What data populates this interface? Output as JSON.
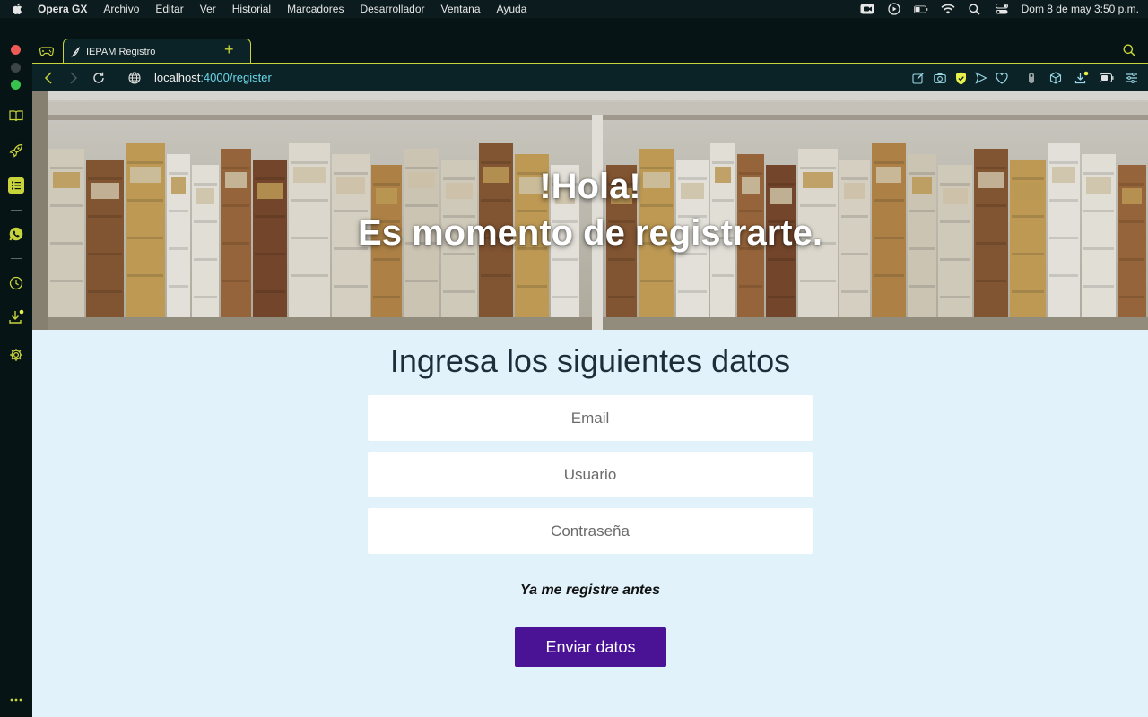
{
  "menubar": {
    "app": "Opera GX",
    "items": [
      "Archivo",
      "Editar",
      "Ver",
      "Historial",
      "Marcadores",
      "Desarrollador",
      "Ventana",
      "Ayuda"
    ],
    "clock": "Dom 8 de may  3:50 p.m."
  },
  "browser": {
    "tab_title": "IEPAM Registro",
    "new_tab": "+",
    "url_host": "localhost",
    "url_path": ":4000/register"
  },
  "page": {
    "hero_line1": "!Hola!",
    "hero_line2": "Es momento de registrarte.",
    "form_title": "Ingresa los siguientes datos",
    "fields": {
      "email_placeholder": "Email",
      "user_placeholder": "Usuario",
      "password_placeholder": "Contraseña"
    },
    "login_link": "Ya me registre antes",
    "submit_label": "Enviar datos"
  },
  "colors": {
    "accent": "#c8d43a",
    "page_bg": "#e1f2fb",
    "button": "#4a1294",
    "title": "#1d2e3a"
  },
  "icons": [
    "apple-icon",
    "camera-icon",
    "play-icon",
    "battery-icon",
    "wifi-icon",
    "search-icon",
    "control-center-icon",
    "book-icon",
    "rocket-icon",
    "notes-icon",
    "whatsapp-icon",
    "clock-icon",
    "download-icon",
    "gear-icon",
    "more-icon"
  ]
}
